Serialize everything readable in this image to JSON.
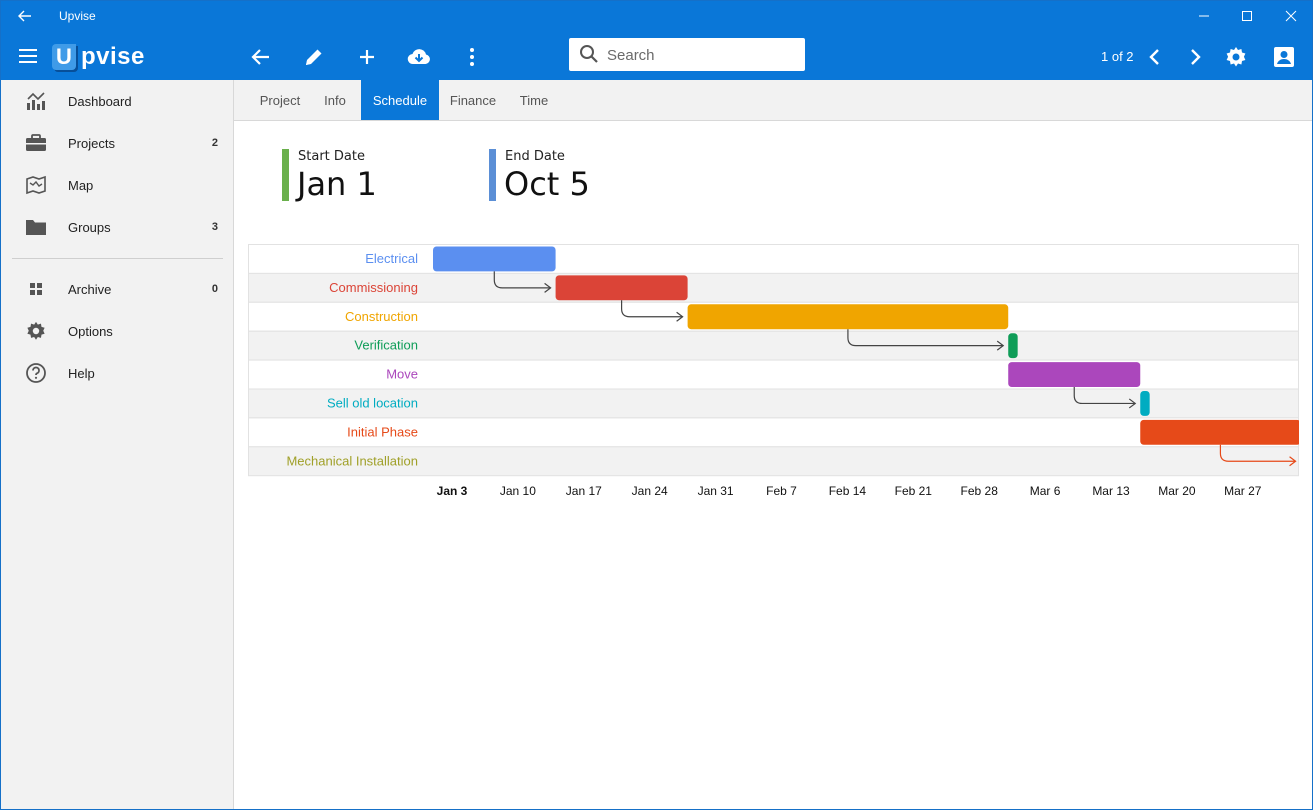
{
  "window": {
    "title": "Upvise"
  },
  "icons": {
    "titlebar_back": "arrow-left-icon",
    "minimize": "minimize-icon",
    "maximize": "maximize-icon",
    "close": "close-icon",
    "menu": "hamburger-menu-icon",
    "back": "arrow-left-icon",
    "edit": "pencil-icon",
    "add": "plus-icon",
    "download": "cloud-download-icon",
    "more": "more-vertical-icon",
    "search": "search-icon",
    "prev": "chevron-left-icon",
    "next": "chevron-right-icon",
    "settings": "gear-icon",
    "account": "account-box-icon"
  },
  "logo": {
    "letter": "U",
    "rest": "pvise"
  },
  "search": {
    "placeholder": "Search",
    "value": ""
  },
  "pager": {
    "text": "1 of 2"
  },
  "sidebar": {
    "items": [
      {
        "label": "Dashboard",
        "count": "",
        "icon": "dashboard-chart-icon"
      },
      {
        "label": "Projects",
        "count": "2",
        "icon": "briefcase-icon"
      },
      {
        "label": "Map",
        "count": "",
        "icon": "map-icon"
      },
      {
        "label": "Groups",
        "count": "3",
        "icon": "folder-icon"
      }
    ],
    "items2": [
      {
        "label": "Archive",
        "count": "0",
        "icon": "grid-icon"
      },
      {
        "label": "Options",
        "count": "",
        "icon": "gear-icon"
      },
      {
        "label": "Help",
        "count": "",
        "icon": "help-circle-icon"
      }
    ]
  },
  "tabs": [
    {
      "label": "Project",
      "active": false
    },
    {
      "label": "Info",
      "active": false
    },
    {
      "label": "Schedule",
      "active": true
    },
    {
      "label": "Finance",
      "active": false
    },
    {
      "label": "Time",
      "active": false
    }
  ],
  "dates": {
    "start": {
      "label": "Start Date",
      "value": "Jan 1",
      "color": "#6ab04c"
    },
    "end": {
      "label": "End Date",
      "value": "Oct 5",
      "color": "#5b8fd6"
    }
  },
  "colors": {
    "accent": "#0a77d8",
    "sidebar_bg": "#f2f2f2"
  },
  "chart_data": {
    "type": "gantt",
    "x_ticks": [
      "Jan 3",
      "Jan 10",
      "Jan 17",
      "Jan 24",
      "Jan 31",
      "Feb 7",
      "Feb 14",
      "Feb 21",
      "Feb 28",
      "Mar 6",
      "Mar 13",
      "Mar 20",
      "Mar 27"
    ],
    "x_range": [
      "2024-01-01",
      "2024-04-01"
    ],
    "tasks": [
      {
        "name": "Electrical",
        "start": "2024-01-01",
        "end": "2024-01-14",
        "color": "#5b8ff0"
      },
      {
        "name": "Commissioning",
        "start": "2024-01-14",
        "end": "2024-01-28",
        "color": "#db4437"
      },
      {
        "name": "Construction",
        "start": "2024-01-28",
        "end": "2024-03-02",
        "color": "#f0a500"
      },
      {
        "name": "Verification",
        "start": "2024-03-02",
        "end": "2024-03-03",
        "color": "#0f9d58"
      },
      {
        "name": "Move",
        "start": "2024-03-02",
        "end": "2024-03-16",
        "color": "#ab47bc"
      },
      {
        "name": "Sell old location",
        "start": "2024-03-16",
        "end": "2024-03-17",
        "color": "#00acc1"
      },
      {
        "name": "Initial Phase",
        "start": "2024-03-16",
        "end": "2024-04-02",
        "color": "#e64a19"
      },
      {
        "name": "Mechanical Installation",
        "start": "2024-04-02",
        "end": "2024-04-03",
        "color": "#a0a028"
      }
    ],
    "dependencies": [
      {
        "from": "Electrical",
        "to": "Commissioning"
      },
      {
        "from": "Commissioning",
        "to": "Construction"
      },
      {
        "from": "Construction",
        "to": "Verification"
      },
      {
        "from": "Move",
        "to": "Sell old location"
      },
      {
        "from": "Initial Phase",
        "to": "Mechanical Installation"
      }
    ]
  }
}
